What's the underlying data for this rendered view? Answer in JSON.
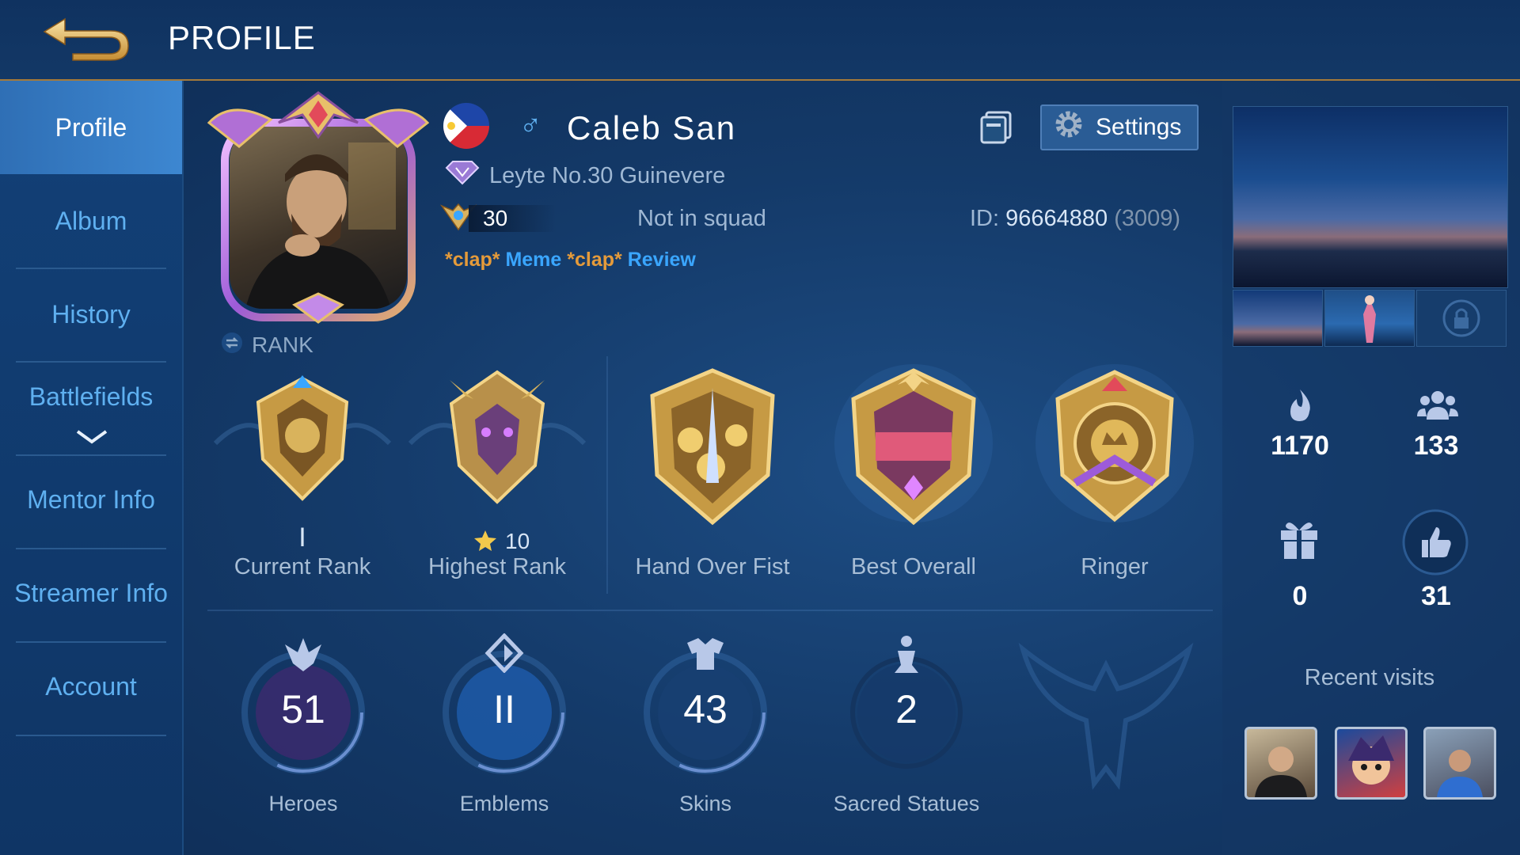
{
  "header": {
    "title": "PROFILE"
  },
  "sidebar": {
    "items": [
      {
        "label": "Profile",
        "active": true
      },
      {
        "label": "Album"
      },
      {
        "label": "History"
      },
      {
        "label": "Battlefields"
      },
      {
        "label": "Mentor Info"
      },
      {
        "label": "Streamer Info"
      },
      {
        "label": "Account"
      }
    ]
  },
  "player": {
    "name": "Caleb San",
    "gender_symbol": "♂",
    "title": "Leyte No.30 Guinevere",
    "level": "30",
    "squad": "Not in squad",
    "id_label": "ID:",
    "id": "96664880",
    "server": "(3009)",
    "signature": {
      "clap1": "*clap*",
      "w1": "Meme",
      "clap2": "*clap*",
      "w2": "Review"
    },
    "rank_label": "RANK"
  },
  "settings_label": "Settings",
  "achievements": [
    {
      "label": "Current Rank",
      "sub": "I"
    },
    {
      "label": "Highest Rank",
      "sub": "10"
    },
    {
      "label": "Hand Over Fist"
    },
    {
      "label": "Best Overall"
    },
    {
      "label": "Ringer"
    }
  ],
  "stats": [
    {
      "label": "Heroes",
      "value": "51"
    },
    {
      "label": "Emblems",
      "value": "II"
    },
    {
      "label": "Skins",
      "value": "43"
    },
    {
      "label": "Sacred Statues",
      "value": "2"
    }
  ],
  "right_stats": {
    "popularity": "1170",
    "followers": "133",
    "gifts": "0",
    "likes": "31"
  },
  "recent_visits_label": "Recent visits",
  "colors": {
    "accent": "#3aa6ff",
    "gold": "#d8b260",
    "clap": "#e59b3a"
  }
}
